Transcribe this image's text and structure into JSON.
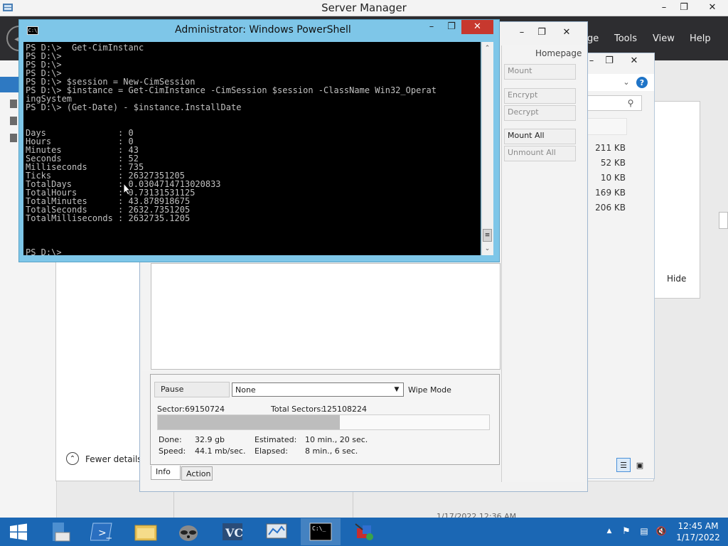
{
  "server_manager": {
    "title": "Server Manager",
    "menu": [
      "ge",
      "Tools",
      "View",
      "Help"
    ],
    "fewer_details": "Fewer details",
    "hide": "Hide",
    "sizes": [
      "211 KB",
      "52 KB",
      "10 KB",
      "169 KB",
      "206 KB"
    ],
    "timestamp": "1/17/2022 12:36 AM"
  },
  "veracrypt": {
    "homepage": "Homepage",
    "buttons": [
      "Mount",
      "Encrypt",
      "Decrypt",
      "Mount All",
      "Unmount All"
    ],
    "pause": "Pause",
    "wipe_value": "None",
    "wipe_label": "Wipe Mode",
    "sector_label": "Sector:",
    "sector_value": "69150724",
    "total_label": "Total Sectors:",
    "total_value": "125108224",
    "done_label": "Done:",
    "done_value": "32.9 gb",
    "speed_label": "Speed:",
    "speed_value": "44.1 mb/sec.",
    "estimated_label": "Estimated:",
    "estimated_value": "10 min., 20 sec.",
    "elapsed_label": "Elapsed:",
    "elapsed_value": "8 min., 6 sec.",
    "progress": 0.55,
    "tabs": [
      "Info",
      "Action"
    ]
  },
  "powershell": {
    "title": "Administrator: Windows PowerShell",
    "console": "PS D:\\>  Get-CimInstanc\nPS D:\\>\nPS D:\\>\nPS D:\\>\nPS D:\\> $session = New-CimSession\nPS D:\\> $instance = Get-CimInstance -CimSession $session -ClassName Win32_Operat\ningSystem\nPS D:\\> (Get-Date) - $instance.InstallDate\n\n\nDays              : 0\nHours             : 0\nMinutes           : 43\nSeconds           : 52\nMilliseconds      : 735\nTicks             : 26327351205\nTotalDays         : 0.0304714713020833\nTotalHours        : 0.73131531125\nTotalMinutes      : 43.878918675\nTotalSeconds      : 2632.7351205\nTotalMilliseconds : 2632735.1205\n\n\n\nPS D:\\> _"
  },
  "taskbar": {
    "time": "12:45 AM",
    "date": "1/17/2022"
  },
  "colors": {
    "taskbar": "#1b67b4",
    "console_bg": "#000000",
    "ps_frame": "#7ec6e8",
    "sm_header": "#2d2d30"
  }
}
